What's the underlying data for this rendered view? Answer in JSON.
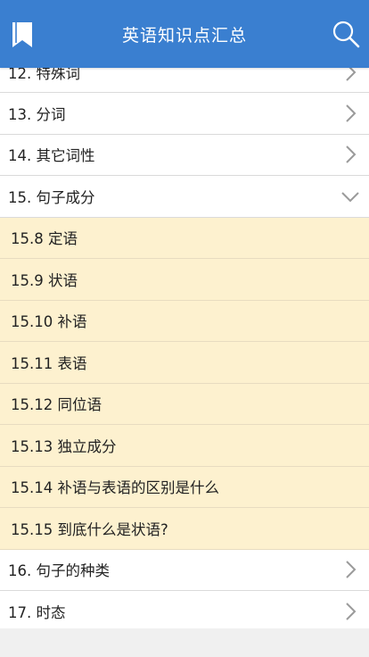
{
  "header": {
    "title": "英语知识点汇总",
    "left_icon": "bookmark-icon",
    "right_icon": "search-icon",
    "bg_color": "#3a7fd0"
  },
  "list": {
    "sections_top": [
      {
        "label": "12. 特殊词",
        "icon": "chevron-right-icon"
      },
      {
        "label": "13. 分词",
        "icon": "chevron-right-icon"
      },
      {
        "label": "14. 其它词性",
        "icon": "chevron-right-icon"
      },
      {
        "label": "15. 句子成分",
        "icon": "chevron-down-icon"
      }
    ],
    "sub_items": [
      {
        "label": "15.8 定语"
      },
      {
        "label": "15.9 状语"
      },
      {
        "label": "15.10 补语"
      },
      {
        "label": "15.11 表语"
      },
      {
        "label": "15.12 同位语"
      },
      {
        "label": "15.13 独立成分"
      },
      {
        "label": "15.14 补语与表语的区别是什么"
      },
      {
        "label": "15.15 到底什么是状语?"
      }
    ],
    "sections_bottom": [
      {
        "label": "16. 句子的种类",
        "icon": "chevron-right-icon"
      },
      {
        "label": "17. 时态",
        "icon": "chevron-right-icon"
      }
    ],
    "sub_bg_color": "#fdf1cf"
  }
}
